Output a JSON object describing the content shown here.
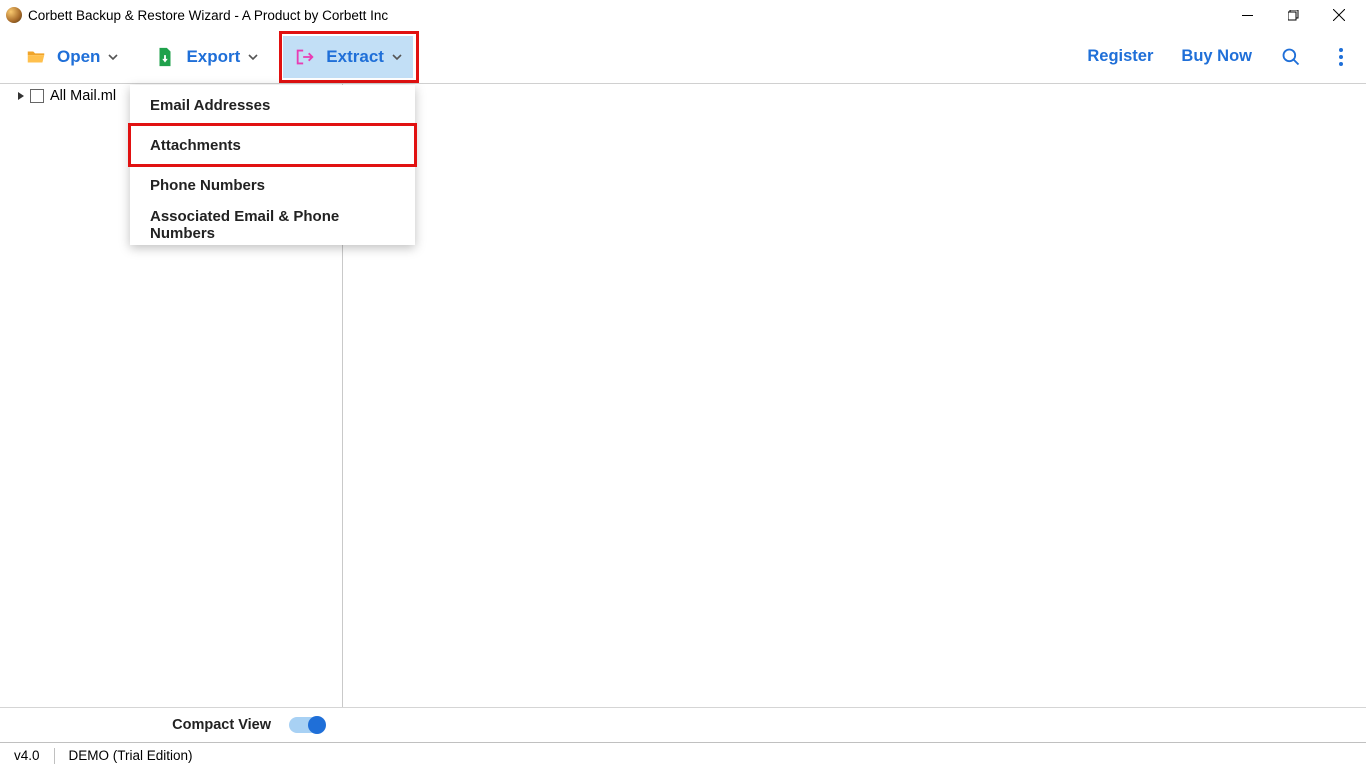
{
  "window": {
    "title": "Corbett Backup & Restore Wizard - A Product by Corbett Inc"
  },
  "toolbar": {
    "open_label": "Open",
    "export_label": "Export",
    "extract_label": "Extract",
    "register_label": "Register",
    "buy_label": "Buy Now"
  },
  "extract_menu": {
    "items": [
      "Email Addresses",
      "Attachments",
      "Phone Numbers",
      "Associated Email & Phone Numbers"
    ]
  },
  "tree": {
    "root_label": "All Mail.ml"
  },
  "compact": {
    "label": "Compact View",
    "enabled": true
  },
  "status": {
    "version": "v4.0",
    "edition": "DEMO (Trial Edition)"
  },
  "colors": {
    "accent_blue": "#1f6fd8",
    "extract_bg": "#c2dff6",
    "highlight_red": "#e11111"
  }
}
